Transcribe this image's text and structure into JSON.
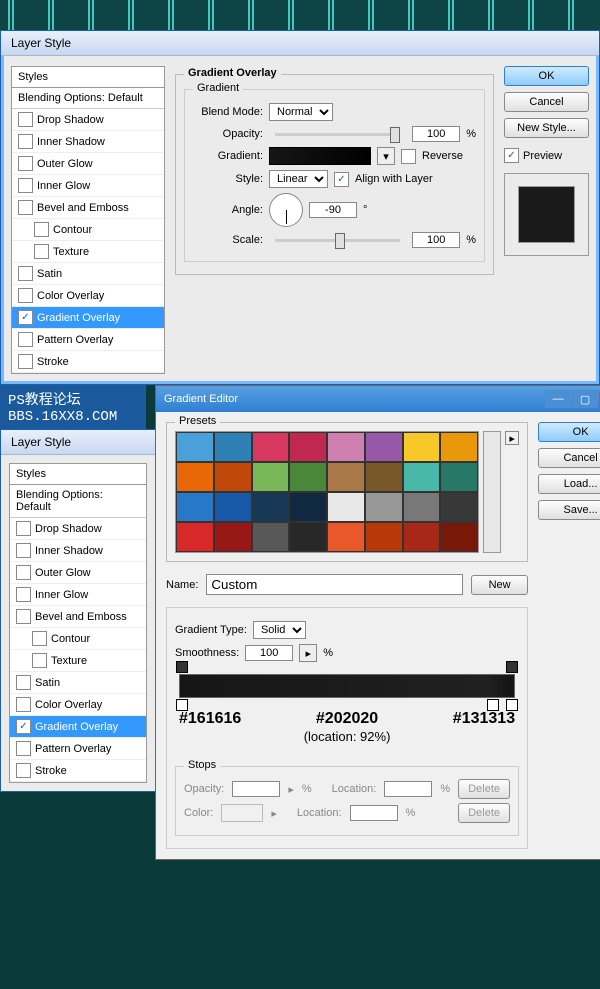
{
  "dialog1": {
    "title": "Layer Style",
    "styles_header": "Styles",
    "blending": "Blending Options: Default",
    "items": [
      {
        "label": "Drop Shadow",
        "checked": false
      },
      {
        "label": "Inner Shadow",
        "checked": false
      },
      {
        "label": "Outer Glow",
        "checked": false
      },
      {
        "label": "Inner Glow",
        "checked": false
      },
      {
        "label": "Bevel and Emboss",
        "checked": false
      },
      {
        "label": "Contour",
        "checked": false,
        "sub": true
      },
      {
        "label": "Texture",
        "checked": false,
        "sub": true
      },
      {
        "label": "Satin",
        "checked": false
      },
      {
        "label": "Color Overlay",
        "checked": false
      },
      {
        "label": "Gradient Overlay",
        "checked": true,
        "selected": true
      },
      {
        "label": "Pattern Overlay",
        "checked": false
      },
      {
        "label": "Stroke",
        "checked": false
      }
    ],
    "panel_title": "Gradient Overlay",
    "sub_title": "Gradient",
    "blend_mode_label": "Blend Mode:",
    "blend_mode": "Normal",
    "opacity_label": "Opacity:",
    "opacity": "100",
    "percent": "%",
    "gradient_label": "Gradient:",
    "reverse": "Reverse",
    "style_label": "Style:",
    "style": "Linear",
    "align": "Align with Layer",
    "angle_label": "Angle:",
    "angle": "-90",
    "degree": "°",
    "scale_label": "Scale:",
    "scale": "100",
    "ok": "OK",
    "cancel": "Cancel",
    "new_style": "New Style...",
    "preview": "Preview"
  },
  "watermark": {
    "line1": "PS教程论坛",
    "line2": "BBS.16XX8.COM"
  },
  "dialog2": {
    "title": "Gradient Editor",
    "presets": "Presets",
    "name_label": "Name:",
    "name": "Custom",
    "new_btn": "New",
    "type_label": "Gradient Type:",
    "type": "Solid",
    "smooth_label": "Smoothness:",
    "smooth": "100",
    "percent": "%",
    "stops": "Stops",
    "opacity_label": "Opacity:",
    "location_label": "Location:",
    "color_label": "Color:",
    "delete": "Delete",
    "ok": "OK",
    "cancel": "Cancel",
    "load": "Load...",
    "save": "Save...",
    "annotations": {
      "c1": "#161616",
      "c2": "#202020",
      "c2_loc": "(location: 92%)",
      "c3": "#131313"
    }
  },
  "chart_data": {
    "type": "table",
    "description": "Gradient color stops",
    "stops": [
      {
        "color": "#161616",
        "location": 0
      },
      {
        "color": "#202020",
        "location": 92
      },
      {
        "color": "#131313",
        "location": 100
      }
    ]
  },
  "preset_colors": [
    "#4aa0d8",
    "#2e7fb4",
    "#d83860",
    "#c02850",
    "#d080b0",
    "#9858a8",
    "#f8c828",
    "#e89808",
    "#e86808",
    "#c04808",
    "#78b858",
    "#488838",
    "#a87848",
    "#785828",
    "#48b8a8",
    "#287868",
    "#2878c8",
    "#1858a8",
    "#183858",
    "#102840",
    "#e8e8e8",
    "#989898",
    "#787878",
    "#383838",
    "#d82828",
    "#981818",
    "#585858",
    "#282828",
    "#e85828",
    "#b83808",
    "#a82818",
    "#781808"
  ]
}
